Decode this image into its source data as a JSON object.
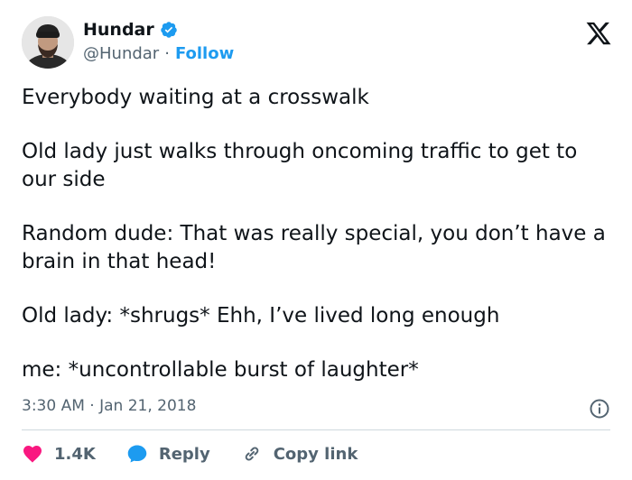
{
  "author": {
    "name": "Hundar",
    "handle": "@Hundar",
    "separator": "·",
    "follow_label": "Follow",
    "verified": true
  },
  "tweet": {
    "paragraphs": [
      "Everybody waiting at a crosswalk",
      "Old lady just walks through oncoming traffic to get to our side",
      "Random dude: That was really special, you don’t have a brain in that head!",
      "Old lady: *shrugs* Ehh, I’ve lived long enough",
      "me: *uncontrollable burst of laughter*"
    ],
    "timestamp": "3:30 AM · Jan 21, 2018"
  },
  "actions": {
    "likes": "1.4K",
    "reply_label": "Reply",
    "copy_label": "Copy link"
  },
  "colors": {
    "accent": "#1d9bf0",
    "like": "#f91880",
    "text": "#0f1419",
    "muted": "#536471"
  },
  "icons": [
    "x-logo-icon",
    "verified-badge-icon",
    "info-icon",
    "heart-icon",
    "reply-bubble-icon",
    "link-icon"
  ]
}
